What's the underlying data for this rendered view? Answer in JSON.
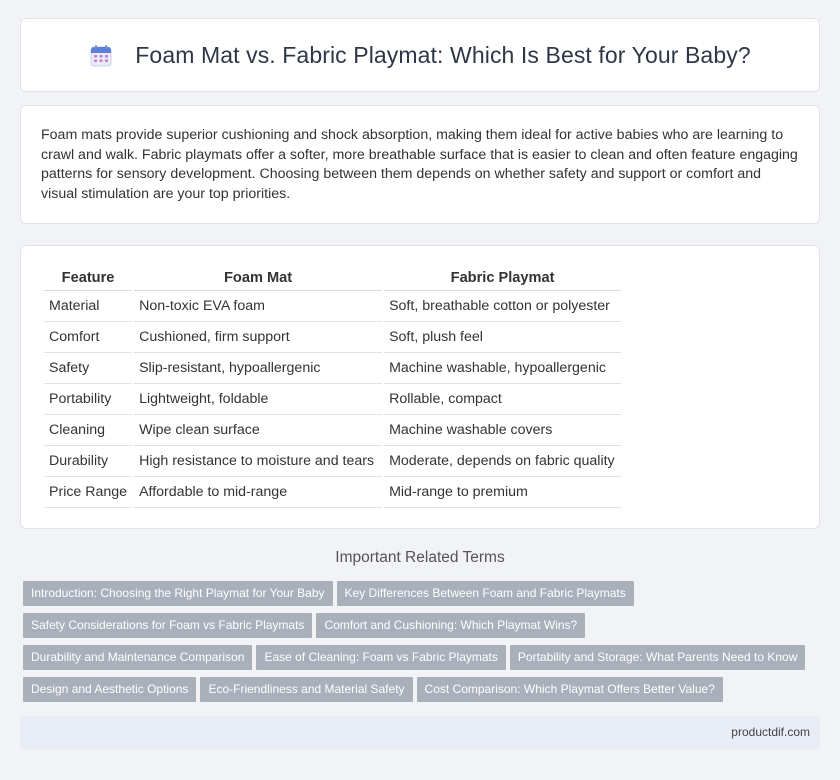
{
  "header": {
    "title": "Foam Mat vs. Fabric Playmat: Which Is Best for Your Baby?",
    "icon": "calendar-icon"
  },
  "intro": {
    "text": "Foam mats provide superior cushioning and shock absorption, making them ideal for active babies who are learning to crawl and walk. Fabric playmats offer a softer, more breathable surface that is easier to clean and often feature engaging patterns for sensory development. Choosing between them depends on whether safety and support or comfort and visual stimulation are your top priorities."
  },
  "table": {
    "headers": [
      "Feature",
      "Foam Mat",
      "Fabric Playmat"
    ],
    "rows": [
      [
        "Material",
        "Non-toxic EVA foam",
        "Soft, breathable cotton or polyester"
      ],
      [
        "Comfort",
        "Cushioned, firm support",
        "Soft, plush feel"
      ],
      [
        "Safety",
        "Slip-resistant, hypoallergenic",
        "Machine washable, hypoallergenic"
      ],
      [
        "Portability",
        "Lightweight, foldable",
        "Rollable, compact"
      ],
      [
        "Cleaning",
        "Wipe clean surface",
        "Machine washable covers"
      ],
      [
        "Durability",
        "High resistance to moisture and tears",
        "Moderate, depends on fabric quality"
      ],
      [
        "Price Range",
        "Affordable to mid-range",
        "Mid-range to premium"
      ]
    ]
  },
  "related": {
    "title": "Important Related Terms",
    "tags": [
      "Introduction: Choosing the Right Playmat for Your Baby",
      "Key Differences Between Foam and Fabric Playmats",
      "Safety Considerations for Foam vs Fabric Playmats",
      "Comfort and Cushioning: Which Playmat Wins?",
      "Durability and Maintenance Comparison",
      "Ease of Cleaning: Foam vs Fabric Playmats",
      "Portability and Storage: What Parents Need to Know",
      "Design and Aesthetic Options",
      "Eco-Friendliness and Material Safety",
      "Cost Comparison: Which Playmat Offers Better Value?"
    ]
  },
  "footer": {
    "text": "productdif.com"
  },
  "colors": {
    "tag_bg": "#a9b0ba",
    "footer_bg": "#e8ecf5",
    "icon_accent": "#5b7fd8"
  }
}
